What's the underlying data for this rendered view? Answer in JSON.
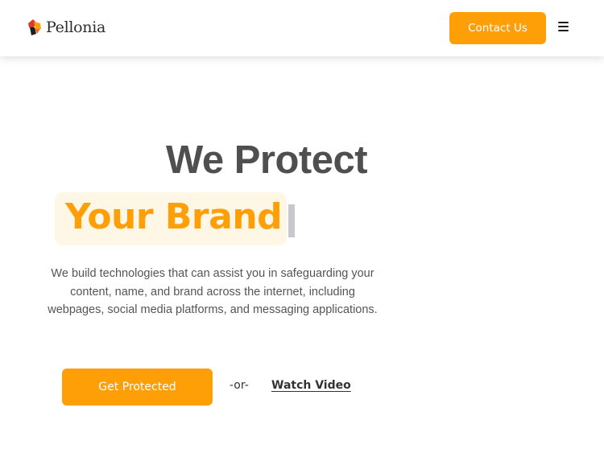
{
  "header": {
    "logo_text": "Pellonia",
    "contact_label": "Contact Us",
    "menu_icon": "hamburger-icon"
  },
  "hero": {
    "title": "We Protect",
    "highlight": "Your Brand",
    "description": "We build technologies that can assist you in safeguarding your content, name, and brand across the internet, including webpages, social media platforms, and messaging applications.",
    "cta_label": "Get Protected",
    "or_text": "-or-",
    "video_label": "Watch Video"
  },
  "colors": {
    "accent": "#ff9f07",
    "highlight_bg": "#fff7e6",
    "heading": "#4f4f4f",
    "logo_red": "#d93a2b",
    "logo_orange": "#ff9f07"
  }
}
